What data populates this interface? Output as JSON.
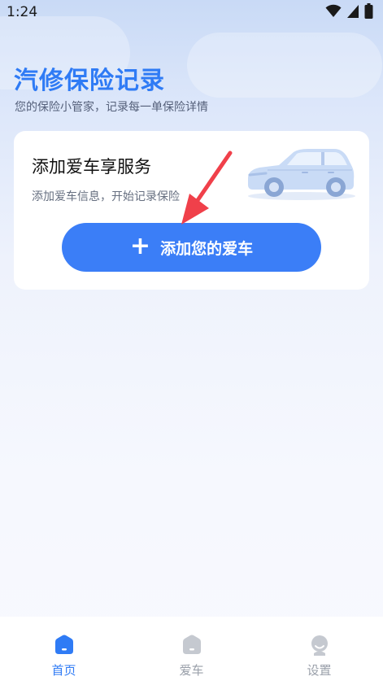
{
  "status_bar": {
    "time": "1:24"
  },
  "header": {
    "title": "汽修保险记录",
    "subtitle": "您的保险小管家，记录每一单保险详情"
  },
  "card": {
    "title": "添加爱车享服务",
    "description": "添加爱车信息，开始记录保险",
    "button_icon": "+",
    "button_label": "添加您的爱车"
  },
  "nav": {
    "items": [
      {
        "label": "首页",
        "icon": "home-icon",
        "active": true
      },
      {
        "label": "爱车",
        "icon": "car-icon",
        "active": false
      },
      {
        "label": "设置",
        "icon": "user-icon",
        "active": false
      }
    ]
  },
  "colors": {
    "accent": "#2f7bf5",
    "button": "#3b7ef7",
    "inactive": "#c5c9d0",
    "annotation_arrow": "#f0404a"
  }
}
